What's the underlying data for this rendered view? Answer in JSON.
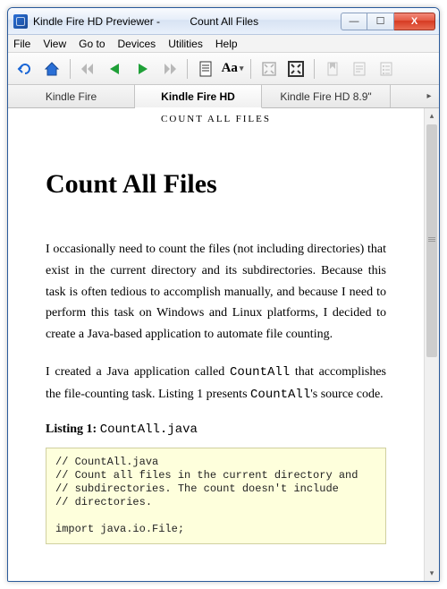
{
  "window": {
    "title": "Kindle Fire HD Previewer -          Count All Files",
    "controls": {
      "min": "—",
      "max": "☐",
      "close": "X"
    }
  },
  "menubar": [
    "File",
    "View",
    "Go to",
    "Devices",
    "Utilities",
    "Help"
  ],
  "toolbar": {
    "font_label": "Aa"
  },
  "tabs": {
    "items": [
      "Kindle Fire",
      "Kindle Fire HD",
      "Kindle Fire HD 8.9\""
    ],
    "active_index": 1
  },
  "document": {
    "running_head": "COUNT ALL FILES",
    "title": "Count All Files",
    "para1_a": "I occasionally need to count the files (not including directories) that exist in the current directory and its subdirectories. Because this task is often tedious to accomplish manually, and because I need to perform this task on Windows and Linux platforms, I decided to create a Java-based application to automate file counting.",
    "para2_a": "I created a Java application called ",
    "para2_code": "CountAll",
    "para2_b": " that accomplishes the file-counting task. Listing 1 presents ",
    "para2_code2": "CountAll",
    "para2_c": "'s source code.",
    "listing_label_bold": "Listing 1:",
    "listing_label_code": "CountAll.java",
    "code": "// CountAll.java\n// Count all files in the current directory and\n// subdirectories. The count doesn't include\n// directories.\n\nimport java.io.File;"
  }
}
